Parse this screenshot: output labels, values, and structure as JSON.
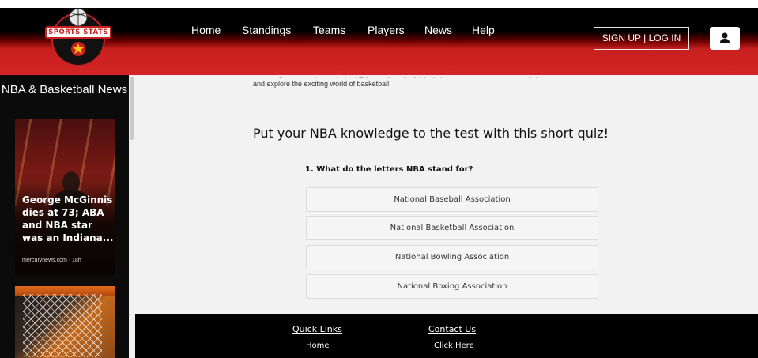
{
  "header": {
    "logo_text": "SPORTS STATS",
    "nav": [
      "Home",
      "Standings",
      "Teams",
      "Players",
      "News",
      "Help"
    ],
    "signup_label": "SIGN UP | LOG IN",
    "user_icon": "user-icon"
  },
  "sidebar": {
    "title": "NBA & Basketball News",
    "card": {
      "headline": "George McGinnis dies at 73; ABA and NBA star was an Indiana...",
      "source": "mercurynews.com",
      "age": "18h"
    }
  },
  "main": {
    "intro_cut": "games. Stay up to date with the NBA standings, individual player stats, and team stats. Join us",
    "intro_line": "and explore the exciting world of basketball!",
    "quiz_title": "Put your NBA knowledge to the test with this short quiz!",
    "question": "1. What do the letters NBA stand for?",
    "options": [
      "National Baseball Association",
      "National Basketball Association",
      "National Bowling Association",
      "National Boxing Association"
    ]
  },
  "footer": {
    "quick_links_title": "Quick Links",
    "quick_links_home": "Home",
    "contact_title": "Contact Us",
    "contact_link": "Click Here"
  },
  "colors": {
    "header_black": "#000000",
    "header_red": "#d32525",
    "footer": "#000000",
    "content_bg": "#f2f2f2"
  }
}
